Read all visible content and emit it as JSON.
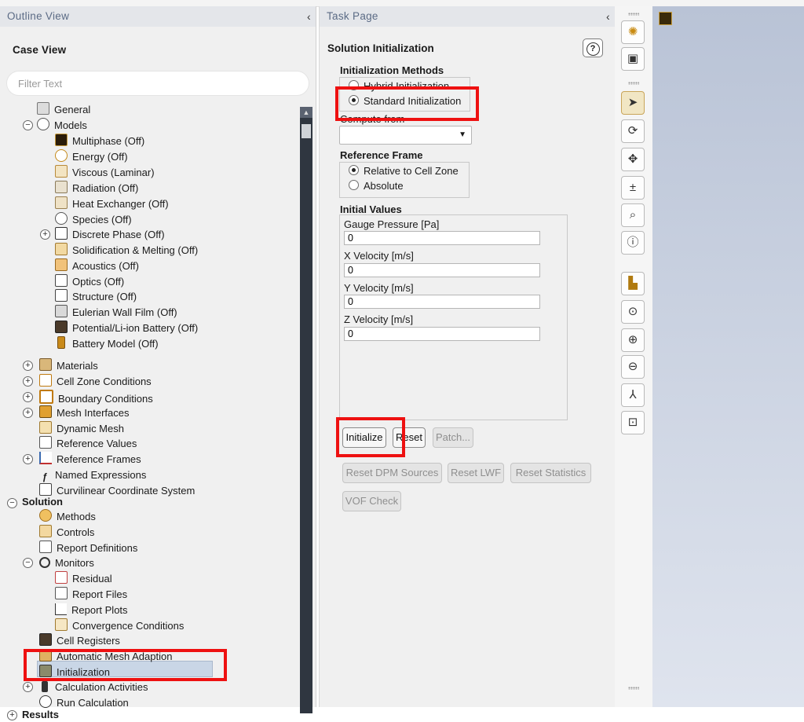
{
  "outline": {
    "header": "Outline View",
    "case_view": "Case View",
    "filter_placeholder": "Filter Text",
    "tree": {
      "general": "General",
      "models": "Models",
      "model_items": [
        "Multiphase (Off)",
        "Energy (Off)",
        "Viscous (Laminar)",
        "Radiation (Off)",
        "Heat Exchanger (Off)",
        "Species (Off)",
        "Discrete Phase (Off)",
        "Solidification & Melting (Off)",
        "Acoustics (Off)",
        "Optics (Off)",
        "Structure (Off)",
        "Eulerian Wall Film (Off)",
        "Potential/Li-ion Battery (Off)",
        "Battery Model (Off)"
      ],
      "setup_items": [
        "Materials",
        "Cell Zone Conditions",
        "Boundary Conditions",
        "Mesh Interfaces",
        "Dynamic Mesh",
        "Reference Values",
        "Reference Frames",
        "Named Expressions",
        "Curvilinear Coordinate System"
      ],
      "solution": "Solution",
      "solution_items": [
        "Methods",
        "Controls",
        "Report Definitions",
        "Monitors"
      ],
      "monitor_items": [
        "Residual",
        "Report Files",
        "Report Plots",
        "Convergence Conditions"
      ],
      "solution_items_2": [
        "Cell Registers",
        "Automatic Mesh Adaption",
        "Initialization",
        "Calculation Activities",
        "Run Calculation"
      ],
      "results": "Results"
    }
  },
  "task": {
    "header": "Task Page",
    "title": "Solution Initialization",
    "methods_label": "Initialization Methods",
    "methods": [
      "Hybrid Initialization",
      "Standard Initialization"
    ],
    "selected_method": "Standard Initialization",
    "compute_from_label": "Compute from",
    "compute_from_value": "",
    "reference_frame_label": "Reference Frame",
    "reference_frames": [
      "Relative to Cell Zone",
      "Absolute"
    ],
    "selected_reference_frame": "Relative to Cell Zone",
    "initial_values_label": "Initial Values",
    "fields": [
      {
        "label": "Gauge Pressure [Pa]",
        "value": "0"
      },
      {
        "label": "X Velocity [m/s]",
        "value": "0"
      },
      {
        "label": "Y Velocity [m/s]",
        "value": "0"
      },
      {
        "label": "Z Velocity [m/s]",
        "value": "0"
      }
    ],
    "buttons": {
      "initialize": "Initialize",
      "reset": "Reset",
      "patch": "Patch...",
      "reset_dpm": "Reset DPM Sources",
      "reset_lwf": "Reset LWF",
      "reset_statistics": "Reset Statistics",
      "vof_check": "VOF Check"
    }
  },
  "toolbar_icons": [
    "graphics-icon",
    "box-view-icon",
    "select-pointer-icon",
    "rotate-icon",
    "pan-icon",
    "zoom-in-out-icon",
    "zoom-icon",
    "probe-info-icon",
    "colormap-icon",
    "fit-view-icon",
    "zoom-to-area-icon",
    "zoom-out-icon",
    "axes-icon",
    "screenshot-icon"
  ],
  "colors": {
    "highlight": "#ee1111",
    "selection": "#c9d6e6",
    "header_text": "#5b6b85"
  }
}
